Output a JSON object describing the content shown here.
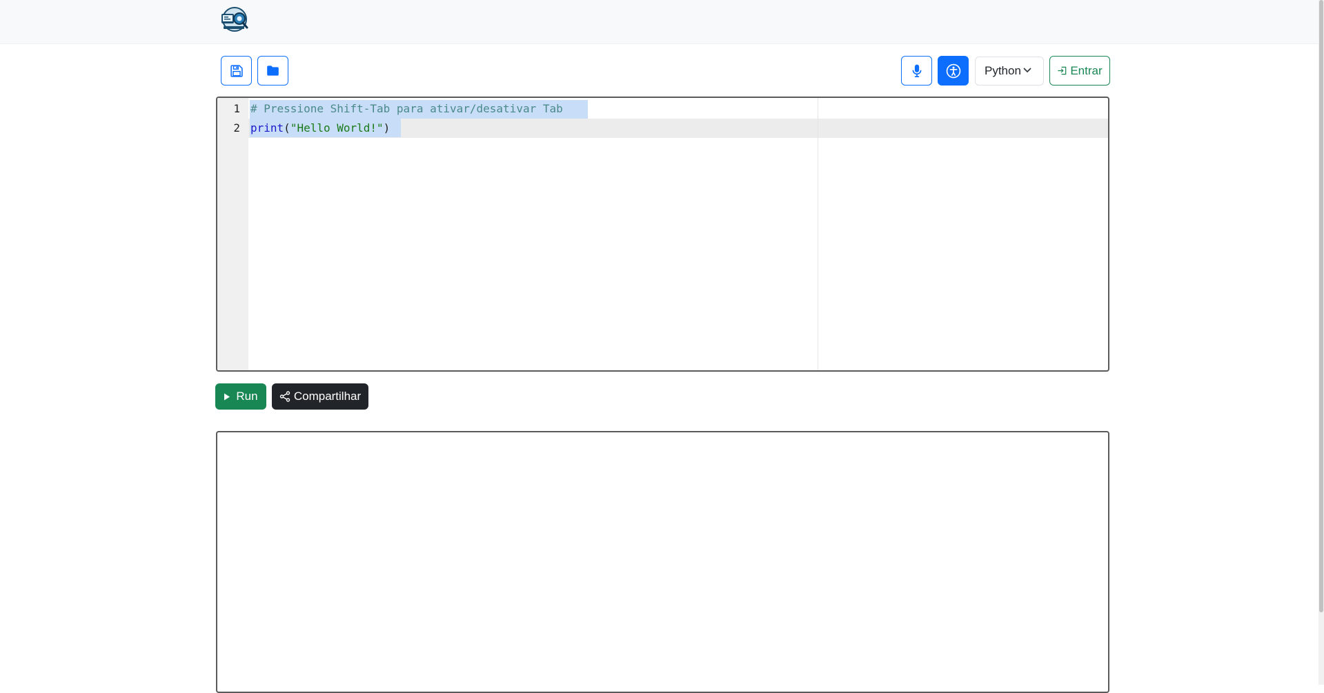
{
  "toolbar": {
    "language_selected": "Python",
    "login_label": "Entrar"
  },
  "editor": {
    "line_numbers": [
      "1",
      "2"
    ],
    "lines": [
      {
        "tokens": [
          {
            "type": "comment",
            "text": "# Pressione Shift-Tab para ativar/desativar Tab"
          }
        ]
      },
      {
        "tokens": [
          {
            "type": "kw",
            "text": "print"
          },
          {
            "type": "punc",
            "text": "("
          },
          {
            "type": "str",
            "text": "\"Hello World!\""
          },
          {
            "type": "punc",
            "text": ")"
          }
        ]
      }
    ]
  },
  "actions": {
    "run_label": "Run",
    "share_label": "Compartilhar"
  },
  "colors": {
    "primary": "#0d6efd",
    "success": "#198754",
    "dark": "#212529",
    "selection": "#c8ddf8"
  }
}
